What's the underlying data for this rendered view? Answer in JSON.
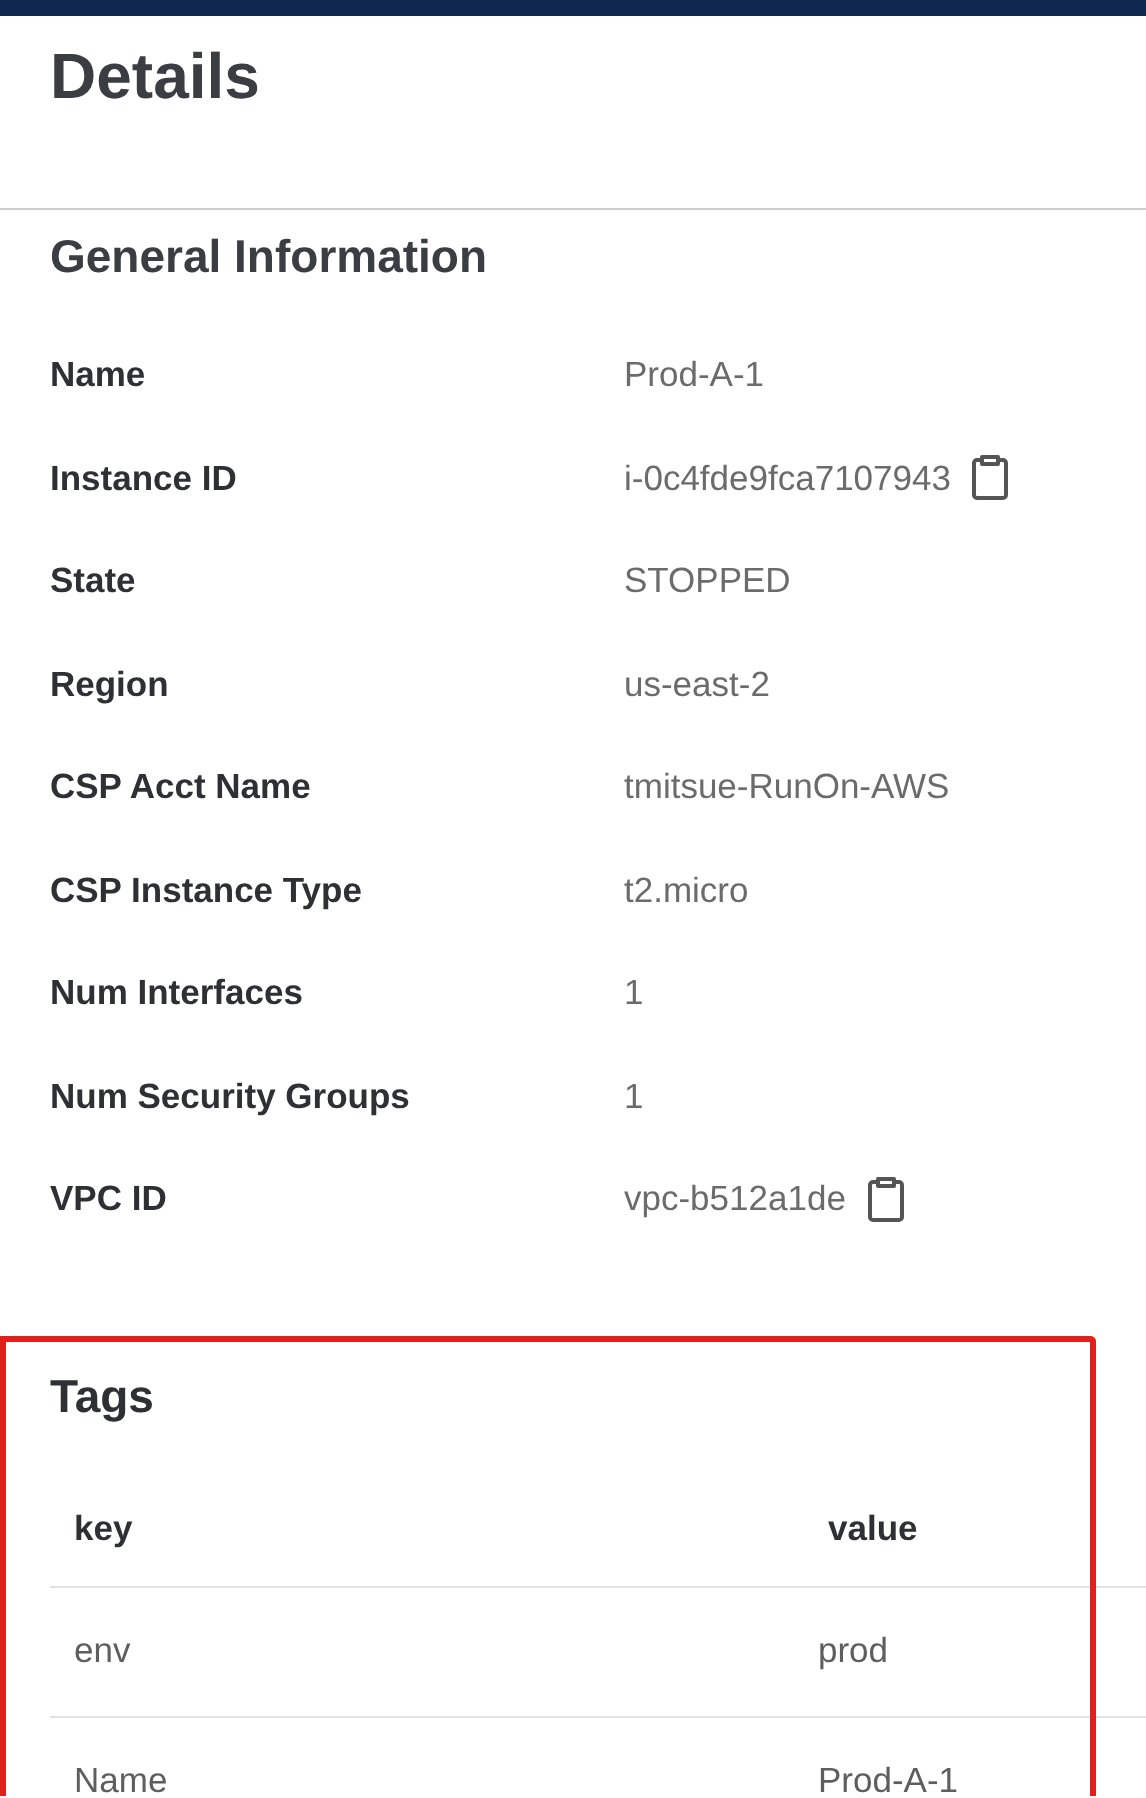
{
  "page": {
    "title": "Details"
  },
  "general_information": {
    "title": "General Information",
    "fields": [
      {
        "label": "Name",
        "value": "Prod-A-1",
        "copyable": false
      },
      {
        "label": "Instance ID",
        "value": "i-0c4fde9fca7107943",
        "copyable": true
      },
      {
        "label": "State",
        "value": "STOPPED",
        "copyable": false
      },
      {
        "label": "Region",
        "value": "us-east-2",
        "copyable": false
      },
      {
        "label": "CSP Acct Name",
        "value": "tmitsue-RunOn-AWS",
        "copyable": false
      },
      {
        "label": "CSP Instance Type",
        "value": "t2.micro",
        "copyable": false
      },
      {
        "label": "Num Interfaces",
        "value": "1",
        "copyable": false
      },
      {
        "label": "Num Security Groups",
        "value": "1",
        "copyable": false
      },
      {
        "label": "VPC ID",
        "value": "vpc-b512a1de",
        "copyable": true
      }
    ]
  },
  "tags": {
    "title": "Tags",
    "highlighted": true,
    "columns": [
      "key",
      "value"
    ],
    "rows": [
      [
        "env",
        "prod"
      ],
      [
        "Name",
        "Prod-A-1"
      ]
    ]
  }
}
